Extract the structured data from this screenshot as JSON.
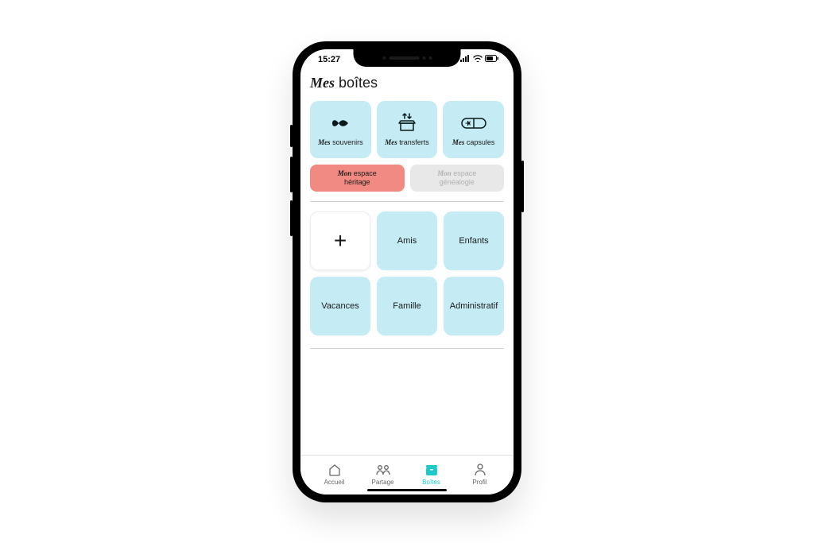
{
  "status": {
    "time": "15:27"
  },
  "page_title": {
    "prefix": "Mes",
    "suffix": " boîtes"
  },
  "top_tiles": [
    {
      "prefix": "Mes",
      "suffix": " souvenirs"
    },
    {
      "prefix": "Mes",
      "suffix": " transferts"
    },
    {
      "prefix": "Mes",
      "suffix": " capsules"
    }
  ],
  "mid_tiles": {
    "heritage": {
      "prefix": "Mon",
      "line1": " espace",
      "line2": "héritage"
    },
    "genealogy": {
      "prefix": "Mon",
      "line1": " espace",
      "line2": "généalogie"
    }
  },
  "boxes": {
    "amis": "Amis",
    "enfants": "Enfants",
    "vacances": "Vacances",
    "famille": "Famille",
    "administratif": "Administratif"
  },
  "tabs": {
    "accueil": "Accueil",
    "partage": "Partage",
    "boites": "Boîtes",
    "profil": "Profil"
  },
  "colors": {
    "tile_blue": "#c5ecf5",
    "heritage_red": "#f08a82",
    "disabled_grey": "#e8e8e8",
    "accent_teal": "#1fc9c9"
  }
}
